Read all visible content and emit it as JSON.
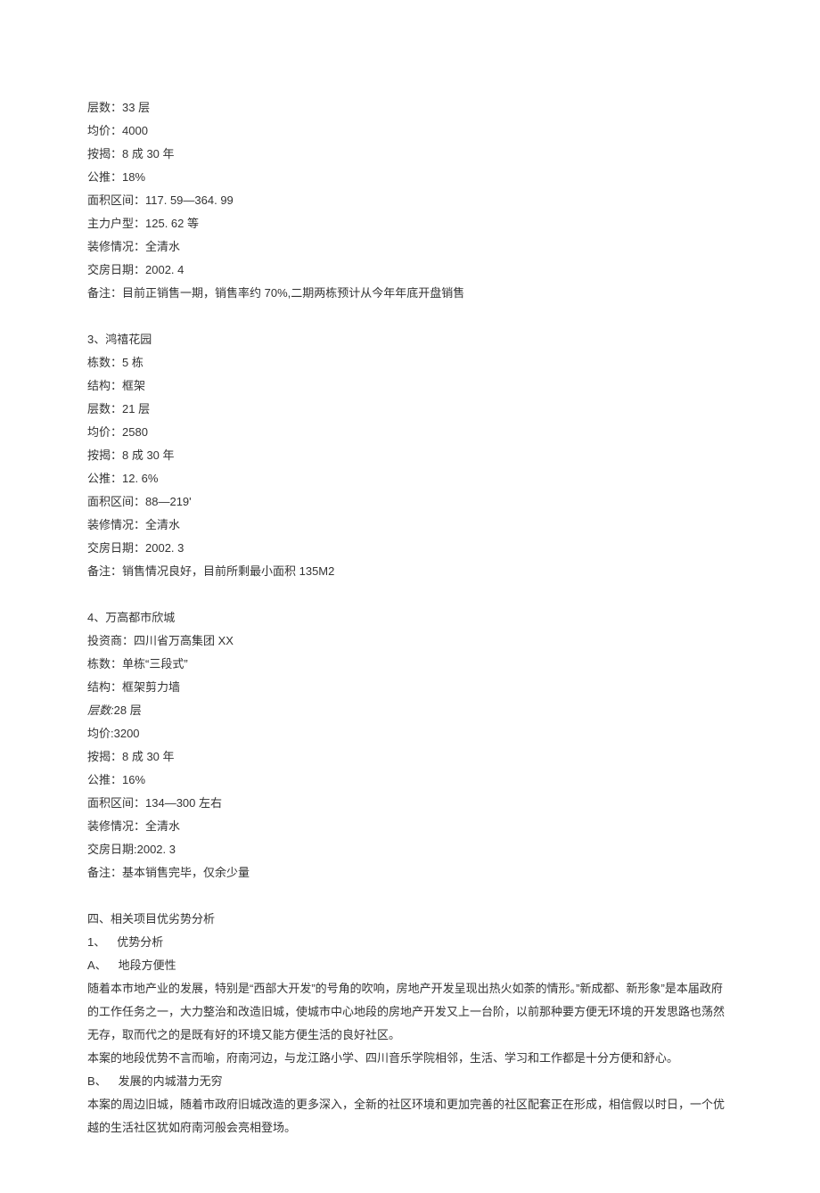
{
  "p2": {
    "floors": "层数：33 层",
    "price": "均价：4000",
    "mortgage": "按揭：8 成 30 年",
    "public": "公推：18%",
    "area": "面积区间：117. 59—364. 99",
    "main_unit": "主力户型：125. 62 等",
    "finish": "装修情况：全清水",
    "delivery": "交房日期：2002. 4",
    "remark": "备注：目前正销售一期，销售率约 70%,二期两栋预计从今年年底开盘销售"
  },
  "p3": {
    "title": "3、鸿禧花园",
    "buildings": "栋数：5 栋",
    "structure": "结构：框架",
    "floors": "层数：21 层",
    "price": "均价：2580",
    "mortgage": "按揭：8 成 30 年",
    "public": "公推：12. 6%",
    "area": "面积区间：88—219'",
    "finish": "装修情况：全清水",
    "delivery": "交房日期：2002. 3",
    "remark": "备注：销售情况良好，目前所剩最小面积 135M2"
  },
  "p4": {
    "title": "4、万高都市欣城",
    "investor": "投资商：四川省万高集团 XX",
    "buildings": "栋数：单栋“三段式”",
    "structure": "结构：框架剪力墙",
    "floors_italic": "层数:",
    "floors_rest": "28 层",
    "price": "均价:3200",
    "mortgage": "按揭：8 成 30 年",
    "public": "公推：16%",
    "area": "面积区间：134—300 左右",
    "finish": "装修情况：全清水",
    "delivery": "交房日期:2002. 3",
    "remark": "备注：基本销售完毕，仅余少量"
  },
  "sec4": {
    "title": "四、相关项目优劣势分析",
    "s1": "1、 优势分析",
    "a": "A、 地段方便性",
    "a_text1": "随着本市地产业的发展，特别是“西部大开发”的号角的吹响，房地产开发呈现出热火如荼的情形。”新成都、新形象”是本届政府的工作任务之一，大力整治和改造旧城，使城市中心地段的房地产开发又上一台阶，以前那种要方便无环境的开发思路也荡然无存，取而代之的是既有好的环境又能方便生活的良好社区。",
    "a_text2": "本案的地段优势不言而喻，府南河边，与龙江路小学、四川音乐学院相邻，生活、学习和工作都是十分方便和舒心。",
    "b": "B、 发展的内城潜力无穷",
    "b_text1": "本案的周边旧城，随着市政府旧城改造的更多深入，全新的社区环境和更加完善的社区配套正在形成，相信假以时日，一个优越的生活社区犹如府南河般会亮相登场。"
  }
}
